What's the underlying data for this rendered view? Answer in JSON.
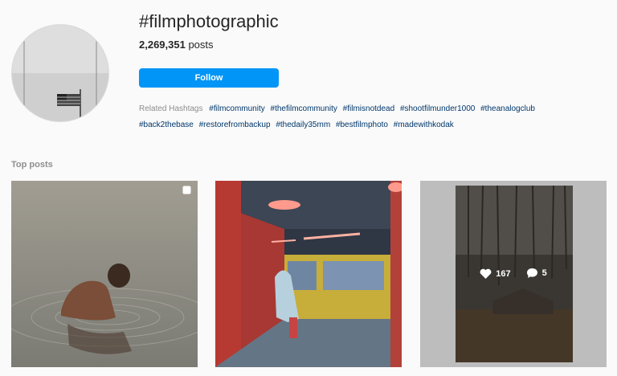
{
  "header": {
    "hashtag": "#filmphotographic",
    "post_count": "2,269,351",
    "post_count_suffix": " posts",
    "follow_label": "Follow"
  },
  "related": {
    "label": "Related Hashtags",
    "tags": [
      "#filmcommunity",
      "#thefilmcommunity",
      "#filmisnotdead",
      "#shootfilmunder1000",
      "#theanalogclub",
      "#back2thebase",
      "#restorefrombackup",
      "#thedaily35mm",
      "#bestfilmphoto",
      "#madewithkodak"
    ]
  },
  "top_posts": {
    "label": "Top posts",
    "posts": [
      {
        "description": "boy in water",
        "likes": "",
        "comments": ""
      },
      {
        "description": "subway station",
        "likes": "",
        "comments": ""
      },
      {
        "description": "cabin in forest",
        "likes": "167",
        "comments": "5"
      }
    ]
  },
  "colors": {
    "accent": "#0095f6",
    "tag_link": "#00376b",
    "muted": "#8e8e8e"
  },
  "icons": {
    "multiple_posts": "carousel-icon",
    "likes": "heart-icon",
    "comments": "comment-icon"
  }
}
